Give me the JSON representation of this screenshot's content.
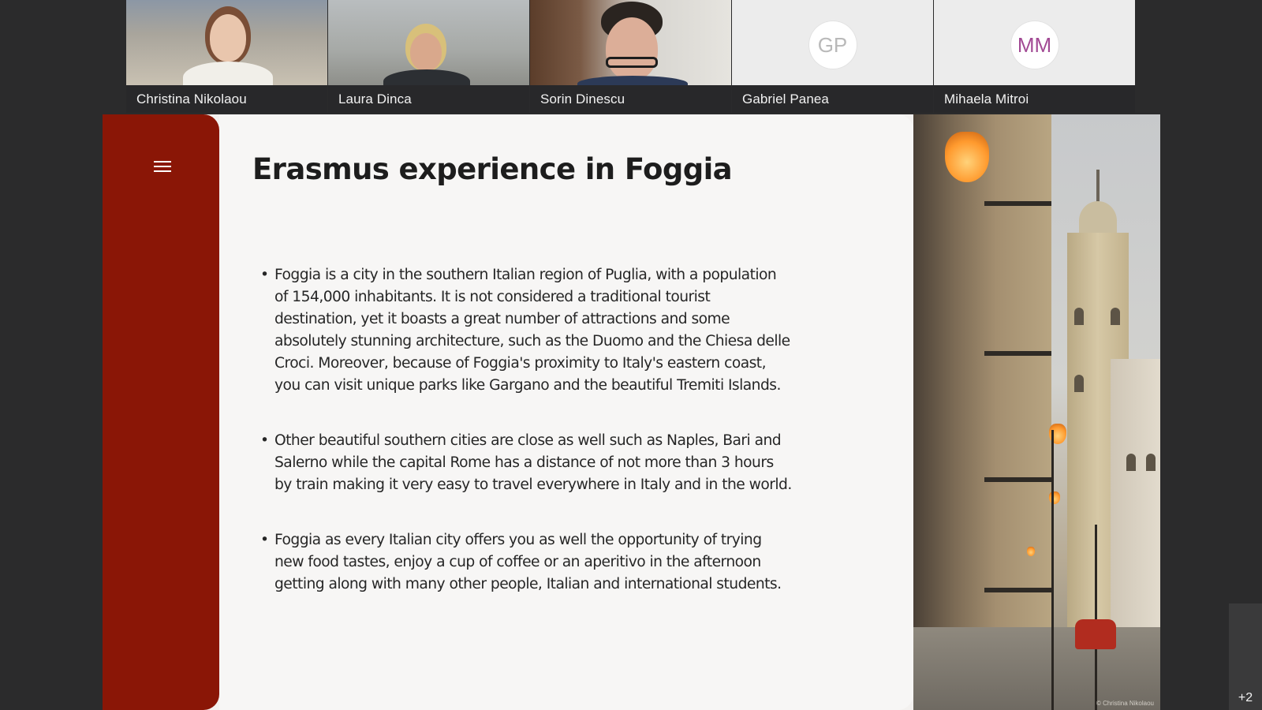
{
  "participants": [
    {
      "name": "Christina Nikolaou",
      "type": "video"
    },
    {
      "name": "Laura Dinca",
      "type": "video"
    },
    {
      "name": "Sorin Dinescu",
      "type": "video"
    },
    {
      "name": "Gabriel Panea",
      "type": "avatar",
      "initials": "GP",
      "avatar_color": "#b9b9b9"
    },
    {
      "name": "Mihaela Mitroi",
      "type": "avatar",
      "initials": "MM",
      "avatar_color": "#a24a94"
    }
  ],
  "slide": {
    "title": "Erasmus experience in Foggia",
    "accent_color": "#8a1606",
    "bullets": [
      "Foggia is a city in the southern Italian region of Puglia, with a population of 154,000 inhabitants. It is not considered a traditional tourist destination, yet it boasts a great number of attractions and some absolutely stunning architecture, such as the Duomo and the Chiesa delle Croci. Moreover, because of Foggia's proximity to Italy's eastern coast, you can visit unique parks like Gargano and the beautiful Tremiti Islands.",
      "Other beautiful southern cities are close as well such as Naples, Bari and Salerno while the capital Rome has a distance of not more than 3 hours by train making it very easy to travel everywhere in Italy and in the world.",
      "Foggia as every Italian city offers you as well the opportunity of trying new food tastes, enjoy a cup of coffee or an aperitivo in the afternoon getting along with many other people, Italian and international students."
    ],
    "photo_credit": "© Christina Nikolaou",
    "menu_icon": "hamburger-menu-icon"
  },
  "overflow": {
    "label": "+2"
  }
}
